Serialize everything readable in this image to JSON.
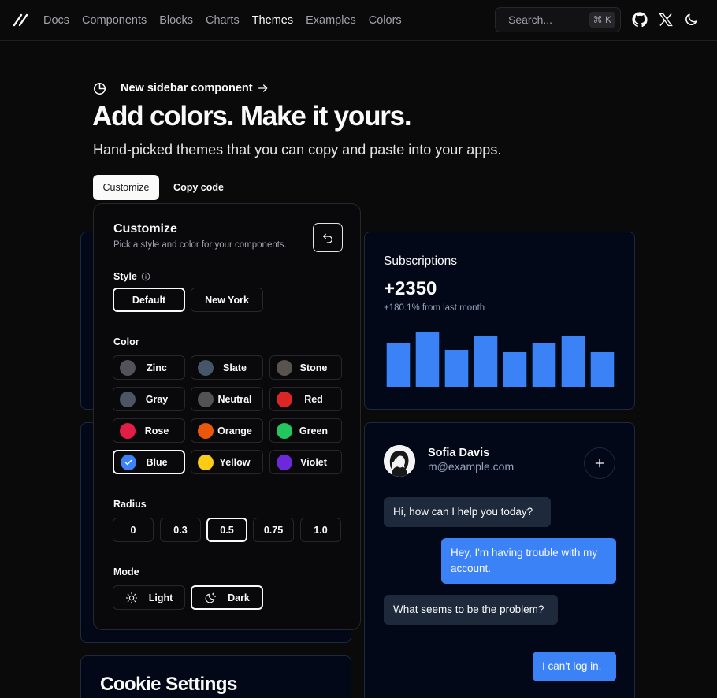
{
  "nav": {
    "items": [
      "Docs",
      "Components",
      "Blocks",
      "Charts",
      "Themes",
      "Examples",
      "Colors"
    ],
    "active": "Themes"
  },
  "search": {
    "placeholder": "Search...",
    "shortcut": "⌘ K"
  },
  "hero": {
    "announcement": "New sidebar component",
    "title": "Add colors. Make it yours.",
    "subtitle": "Hand-picked themes that you can copy and paste into your apps.",
    "customize_label": "Customize",
    "copy_label": "Copy code"
  },
  "customize": {
    "title": "Customize",
    "subtitle": "Pick a style and color for your components.",
    "style_label": "Style",
    "styles": [
      "Default",
      "New York"
    ],
    "selected_style": "Default",
    "color_label": "Color",
    "colors": [
      {
        "name": "Zinc",
        "hex": "#52525b"
      },
      {
        "name": "Slate",
        "hex": "#475569"
      },
      {
        "name": "Stone",
        "hex": "#57534e"
      },
      {
        "name": "Gray",
        "hex": "#4b5563"
      },
      {
        "name": "Neutral",
        "hex": "#525252"
      },
      {
        "name": "Red",
        "hex": "#dc2626"
      },
      {
        "name": "Rose",
        "hex": "#e11d48"
      },
      {
        "name": "Orange",
        "hex": "#ea580c"
      },
      {
        "name": "Green",
        "hex": "#22c55e"
      },
      {
        "name": "Blue",
        "hex": "#3b82f6"
      },
      {
        "name": "Yellow",
        "hex": "#facc15"
      },
      {
        "name": "Violet",
        "hex": "#6d28d9"
      }
    ],
    "selected_color": "Blue",
    "radius_label": "Radius",
    "radii": [
      "0",
      "0.3",
      "0.5",
      "0.75",
      "1.0"
    ],
    "selected_radius": "0.5",
    "mode_label": "Mode",
    "modes": [
      "Light",
      "Dark"
    ],
    "selected_mode": "Dark"
  },
  "cookie": {
    "title": "Cookie Settings"
  },
  "subscriptions": {
    "title": "Subscriptions",
    "value": "+2350",
    "change": "+180.1% from last month",
    "bar_color": "#3b82f6"
  },
  "chart_data": {
    "type": "bar",
    "values": [
      56,
      70,
      47,
      65,
      44,
      56,
      65,
      44
    ],
    "ylim": [
      0,
      80
    ]
  },
  "chat": {
    "name": "Sofia Davis",
    "email": "m@example.com",
    "messages": [
      {
        "role": "agent",
        "text": "Hi, how can I help you today?"
      },
      {
        "role": "user",
        "text": "Hey, I'm having trouble with my account."
      },
      {
        "role": "agent",
        "text": "What seems to be the problem?"
      },
      {
        "role": "user",
        "text": "I can't log in."
      }
    ]
  },
  "colors": {
    "background": "#0a0a0a",
    "card": "#020817",
    "card_border": "#1e293b",
    "accent": "#3b82f6"
  }
}
